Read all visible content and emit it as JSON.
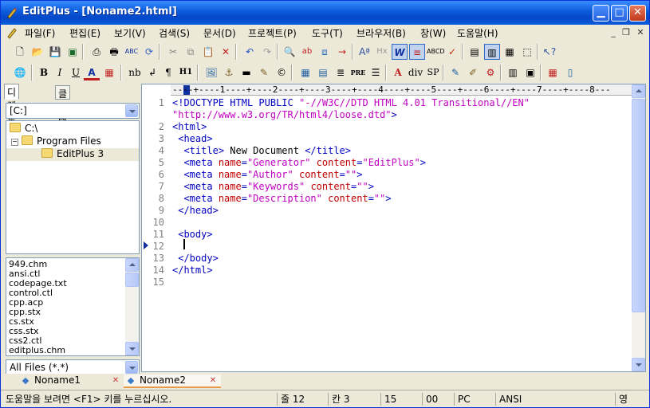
{
  "window": {
    "title": "EditPlus - [Noname2.html]"
  },
  "menu": {
    "items": [
      "파일(F)",
      "편집(E)",
      "보기(V)",
      "검색(S)",
      "문서(D)",
      "프로젝트(P)",
      "도구(T)",
      "브라우저(B)",
      "창(W)",
      "도움말(H)"
    ]
  },
  "toolbar_html": {
    "bold": "B",
    "italic": "I",
    "underline": "U",
    "font_color": "A",
    "nb": "nb",
    "para": "¶",
    "heading": "H1",
    "pre": "PRE",
    "div": "div",
    "span": "SP"
  },
  "left_pane": {
    "tabs": [
      "디렉토리",
      "클립텍스트"
    ],
    "drive": "[C:]",
    "tree": [
      "C:\\",
      "Program Files",
      "EditPlus 3"
    ],
    "files": [
      "949.chm",
      "ansi.ctl",
      "codepage.txt",
      "control.ctl",
      "cpp.acp",
      "cpp.stx",
      "cs.stx",
      "css.stx",
      "css2.ctl",
      "editplus.chm"
    ],
    "filter": "All Files (*.*)"
  },
  "editor": {
    "ruler": "----+----1----+----2----+----3----+----4----+----5----+----6----+----7----+----8---",
    "lines": [
      {
        "n": "1",
        "text": "<!DOCTYPE HTML PUBLIC \"-//W3C//DTD HTML 4.01 Transitional//EN\""
      },
      {
        "n": "",
        "text": "\"http://www.w3.org/TR/html4/loose.dtd\">"
      },
      {
        "n": "2",
        "text": "<html>"
      },
      {
        "n": "3",
        "text": " <head>"
      },
      {
        "n": "4",
        "text": "  <title> New Document </title>"
      },
      {
        "n": "5",
        "text": "  <meta name=\"Generator\" content=\"EditPlus\">"
      },
      {
        "n": "6",
        "text": "  <meta name=\"Author\" content=\"\">"
      },
      {
        "n": "7",
        "text": "  <meta name=\"Keywords\" content=\"\">"
      },
      {
        "n": "8",
        "text": "  <meta name=\"Description\" content=\"\">"
      },
      {
        "n": "9",
        "text": " </head>"
      },
      {
        "n": "10",
        "text": ""
      },
      {
        "n": "11",
        "text": " <body>"
      },
      {
        "n": "12",
        "text": ""
      },
      {
        "n": "13",
        "text": " </body>"
      },
      {
        "n": "14",
        "text": "</html>"
      },
      {
        "n": "15",
        "text": ""
      }
    ]
  },
  "doc_tabs": [
    "Noname1",
    "Noname2"
  ],
  "status": {
    "hint": "도움말을 보려면 <F1> 키를 누르십시오.",
    "line": "줄 12",
    "col": "칸 3",
    "total": "15",
    "flag": "00",
    "mode": "PC",
    "encoding": "ANSI",
    "ime": "영"
  }
}
